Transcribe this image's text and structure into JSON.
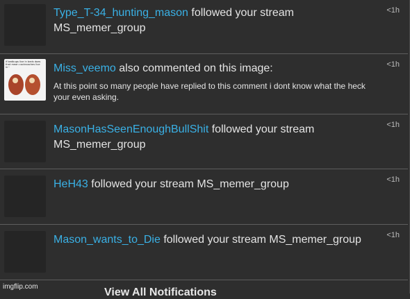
{
  "notifications": [
    {
      "user": "Type_T-34_hunting_mason",
      "action": "followed your stream",
      "target": "MS_memer_group",
      "time": "<1h"
    },
    {
      "user": "Miss_veemo",
      "action": "also commented on this image:",
      "comment": "At this point so many people have replied to this comment i dont know what the heck your even asking.",
      "thumbnail_caption": "if bedbugs live in beds does that mean cockroaches live in~",
      "time": "<1h"
    },
    {
      "user": "MasonHasSeenEnoughBullShit",
      "action": "followed your stream",
      "target": "MS_memer_group",
      "time": "<1h"
    },
    {
      "user": "HeH43",
      "action": "followed your stream",
      "target": "MS_memer_group",
      "time": "<1h"
    },
    {
      "user": "Mason_wants_to_Die",
      "action": "followed your stream",
      "target": "MS_memer_group",
      "time": "<1h"
    }
  ],
  "footer": {
    "watermark": "imgflip.com",
    "heading_partial": "View All Notifications"
  },
  "colors": {
    "background": "#2e2e2e",
    "username_link": "#3ab1e6",
    "text": "#e4e4e4"
  }
}
